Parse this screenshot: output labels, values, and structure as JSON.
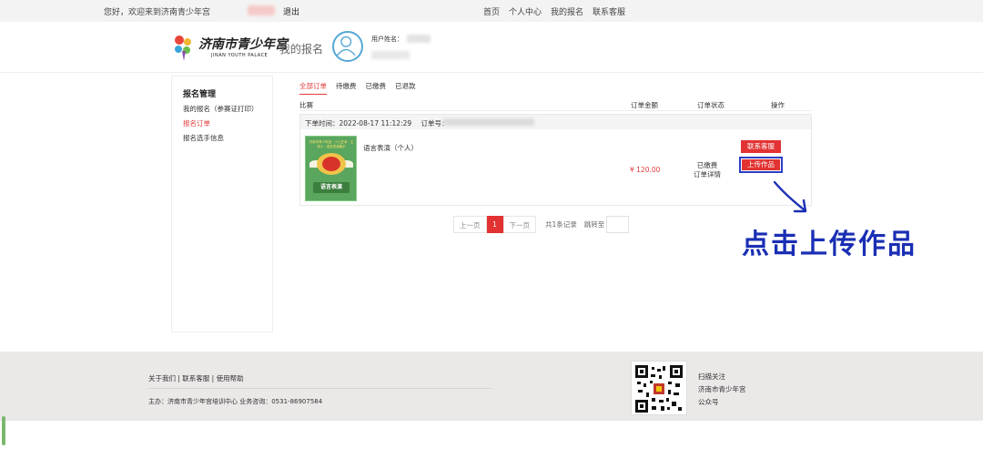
{
  "topbar": {
    "welcome": "您好，欢迎来到济南青少年宫",
    "logout": "退出",
    "nav": [
      "首页",
      "个人中心",
      "我的报名",
      "联系客服"
    ]
  },
  "header": {
    "logo_cn": "济南市青少年宫",
    "logo_en": "JINAN YOUTH PALACE",
    "page_title": "我的报名",
    "username_label": "用户姓名："
  },
  "sidebar": {
    "title": "报名管理",
    "items": [
      {
        "label": "我的报名（参赛证打印）",
        "active": false
      },
      {
        "label": "报名订单",
        "active": true
      },
      {
        "label": "报名选手信息",
        "active": false
      }
    ]
  },
  "tabs": [
    {
      "label": "全部订单",
      "active": true
    },
    {
      "label": "待缴费",
      "active": false
    },
    {
      "label": "已缴费",
      "active": false
    },
    {
      "label": "已退款",
      "active": false
    }
  ],
  "columns": {
    "match": "比赛",
    "amount": "订单金额",
    "status": "订单状态",
    "action": "操作"
  },
  "order": {
    "time_label": "下单时间：2022-08-17 11:12:29",
    "no_label": "订单号：",
    "thumb_title": "济南市青少年宫 · 少儿艺术 · 主持人 · 语言表演展示",
    "thumb_button": "语言表演",
    "product_name": "语言表演（个人）",
    "price": "¥ 120.00",
    "status": "已缴费",
    "detail_link": "订单详情",
    "contact_button": "联系客服",
    "upload_button": "上传作品"
  },
  "pager": {
    "prev": "上一页",
    "current": "1",
    "next": "下一页",
    "total": "共1条记录",
    "jump": "跳转至"
  },
  "annotation": {
    "text": "点击上传作品",
    "color": "#1a2fb4"
  },
  "footer": {
    "links": "关于我们 | 联系客服 | 使用帮助",
    "host": "主办：济南市青少年宫培训中心 业务咨询：0531-86907584",
    "scan_lines": [
      "扫描关注",
      "济南市青少年宫",
      "公众号"
    ]
  },
  "colors": {
    "accent_red": "#e23232",
    "avatar_blue": "#55a7d6",
    "footer_bg": "#ebe8e8"
  }
}
